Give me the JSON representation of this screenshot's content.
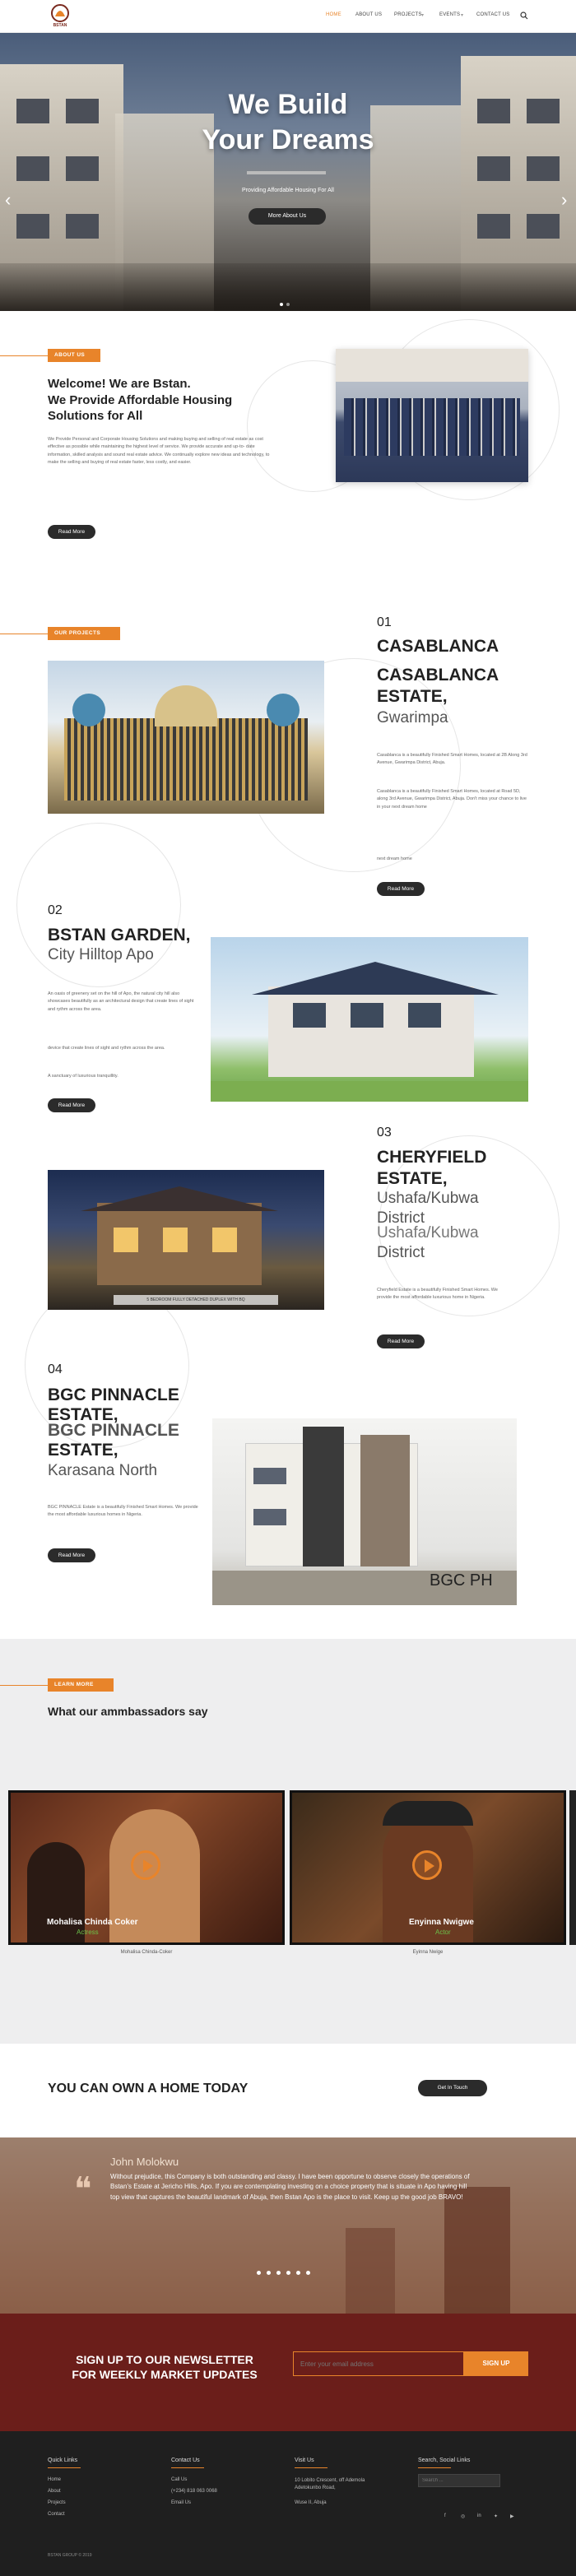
{
  "nav": {
    "items": [
      "HOME",
      "ABOUT US",
      "PROJECTS",
      "EVENTS",
      "CONTACT US"
    ],
    "logo_text": "BSTAN",
    "logo_sub": "GROUP"
  },
  "hero": {
    "title_line1": "We Build",
    "title_line2": "Your Dreams",
    "subtitle": "Providing Affordable Housing For All",
    "button": "More About Us",
    "slide_count": 2
  },
  "about": {
    "tag": "ABOUT US",
    "heading": [
      "Welcome! We are Bstan.",
      "We Provide Affordable Housing",
      "Solutions for All"
    ],
    "body": "We Provide Personal and Corporate Housing Solutions and making buying and selling of real estate as cost effective as possible while maintaining the highest level of service. We provide accurate and up-to- date information, skilled analysis and sound real estate advice. We continually explore new ideas and technology, to make the selling and buying of real estate faster, less costly, and easier.",
    "button": "Read More"
  },
  "projects": {
    "tag": "OUR PROJECTS",
    "items": [
      {
        "num": "01",
        "title1": "CASABLANCA",
        "title2": "CASABLANCA",
        "title3": "ESTATE,",
        "location": "Gwarimpa",
        "desc1": "Casablanca is a beautifully Finished Smart Homes, located at 2B Along 3rd Avenue, Gwarimpa District, Abuja.",
        "desc2": "Casablanca is a beautifully Finished Smart Homes, located at Road 5D, along 3rd Avenue, Gwarimpa District, Abuja. Don't miss your chance to live in your next dream home",
        "desc3": "next dream home",
        "button": "Read More"
      },
      {
        "num": "02",
        "title": "BSTAN GARDEN,",
        "location": "City Hilltop Apo",
        "desc1": "An oasis of greenery set on the hill of Apo, the natural city hill also showcases beautifully as an architectural design that create lines of sight and rythm across the area.",
        "desc2": "device that create lines of sight and rythm across the area.",
        "desc3": "A sanctuary of luxurious tranquillity.",
        "button": "Read More"
      },
      {
        "num": "03",
        "title1": "CHERYFIELD",
        "title2": "ESTATE,",
        "location1": "Ushafa/Kubwa",
        "location2": "District",
        "location_ghost": "Ushafa/Kubwa",
        "location3": "District",
        "desc": "Cheryfield Estate is a beautifully Finished Smart Homes. We provide the most affordable luxurious home in Nigeria.",
        "caption": "5 BEDROOM FULLY DETACHED DUPLEX WITH BQ",
        "button": "Read More"
      },
      {
        "num": "04",
        "title1": "BGC PINNACLE",
        "title2": "ESTATE,",
        "title_ghost": "BGC PINNACLE",
        "title3": "ESTATE,",
        "location": "Karasana North",
        "desc": "BGC PINNACLE Estate is a beautifully Finished Smart Homes. We provide the most affordable luxurious homes in Nigeria.",
        "image_label": "BGC PH",
        "button": "Read More"
      }
    ]
  },
  "ambassadors": {
    "tag": "LEARN MORE",
    "heading": "What our ammbassadors say",
    "videos": [
      {
        "overlay": "Mohalisa Chinda Coker",
        "overlay2": "Actress",
        "caption": "Mohalisa Chinda-Coker"
      },
      {
        "overlay": "Enyinna Nwigwe",
        "overlay2": "Actor",
        "caption": "Eyinna Nwige"
      }
    ]
  },
  "cta": {
    "text": "YOU CAN OWN A HOME TODAY",
    "button": "Get In Touch"
  },
  "testimonial": {
    "name": "John Molokwu",
    "quote": "Without prejudice, this Company is both outstanding and classy. I have been opportune to observe closely the operations of Bstan's Estate at Jericho Hills, Apo. If you are contemplating investing on a choice property that is situate in Apo having hill top view that captures the beautiful landmark of Abuja, then Bstan Apo is the place to visit. Keep up the good job BRAVO!"
  },
  "newsletter": {
    "line1": "SIGN UP TO OUR NEWSLETTER",
    "line2": "FOR WEEKLY MARKET UPDATES",
    "placeholder": "Enter your email address",
    "button": "SIGN UP"
  },
  "footer": {
    "quick_title": "Quick Links",
    "quick": [
      "Home",
      "About",
      "Projects",
      "Contact"
    ],
    "contact_title": "Contact Us",
    "contact": [
      "Call Us",
      "(+234) 818 063 0068",
      "Email Us"
    ],
    "visit_title": "Visit Us",
    "visit": [
      "10 Lobito Crescent, off Ademola Adetokunbo Road,",
      "Wuse II, Abuja"
    ],
    "search_title": "Search, Social Links",
    "search_placeholder": "Search ...",
    "copyright": "BSTAN GROUP © 2019"
  },
  "colors": {
    "accent": "#e8842a",
    "dark": "#2b2b2b",
    "maroon": "#6b1e1a"
  }
}
